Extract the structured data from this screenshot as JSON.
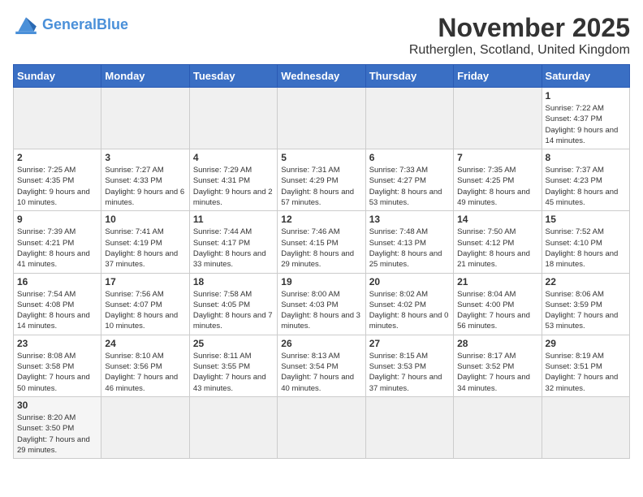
{
  "logo": {
    "general": "General",
    "blue": "Blue"
  },
  "header": {
    "month": "November 2025",
    "location": "Rutherglen, Scotland, United Kingdom"
  },
  "days_of_week": [
    "Sunday",
    "Monday",
    "Tuesday",
    "Wednesday",
    "Thursday",
    "Friday",
    "Saturday"
  ],
  "weeks": [
    [
      {
        "day": "",
        "info": ""
      },
      {
        "day": "",
        "info": ""
      },
      {
        "day": "",
        "info": ""
      },
      {
        "day": "",
        "info": ""
      },
      {
        "day": "",
        "info": ""
      },
      {
        "day": "",
        "info": ""
      },
      {
        "day": "1",
        "info": "Sunrise: 7:22 AM\nSunset: 4:37 PM\nDaylight: 9 hours and 14 minutes."
      }
    ],
    [
      {
        "day": "2",
        "info": "Sunrise: 7:25 AM\nSunset: 4:35 PM\nDaylight: 9 hours and 10 minutes."
      },
      {
        "day": "3",
        "info": "Sunrise: 7:27 AM\nSunset: 4:33 PM\nDaylight: 9 hours and 6 minutes."
      },
      {
        "day": "4",
        "info": "Sunrise: 7:29 AM\nSunset: 4:31 PM\nDaylight: 9 hours and 2 minutes."
      },
      {
        "day": "5",
        "info": "Sunrise: 7:31 AM\nSunset: 4:29 PM\nDaylight: 8 hours and 57 minutes."
      },
      {
        "day": "6",
        "info": "Sunrise: 7:33 AM\nSunset: 4:27 PM\nDaylight: 8 hours and 53 minutes."
      },
      {
        "day": "7",
        "info": "Sunrise: 7:35 AM\nSunset: 4:25 PM\nDaylight: 8 hours and 49 minutes."
      },
      {
        "day": "8",
        "info": "Sunrise: 7:37 AM\nSunset: 4:23 PM\nDaylight: 8 hours and 45 minutes."
      }
    ],
    [
      {
        "day": "9",
        "info": "Sunrise: 7:39 AM\nSunset: 4:21 PM\nDaylight: 8 hours and 41 minutes."
      },
      {
        "day": "10",
        "info": "Sunrise: 7:41 AM\nSunset: 4:19 PM\nDaylight: 8 hours and 37 minutes."
      },
      {
        "day": "11",
        "info": "Sunrise: 7:44 AM\nSunset: 4:17 PM\nDaylight: 8 hours and 33 minutes."
      },
      {
        "day": "12",
        "info": "Sunrise: 7:46 AM\nSunset: 4:15 PM\nDaylight: 8 hours and 29 minutes."
      },
      {
        "day": "13",
        "info": "Sunrise: 7:48 AM\nSunset: 4:13 PM\nDaylight: 8 hours and 25 minutes."
      },
      {
        "day": "14",
        "info": "Sunrise: 7:50 AM\nSunset: 4:12 PM\nDaylight: 8 hours and 21 minutes."
      },
      {
        "day": "15",
        "info": "Sunrise: 7:52 AM\nSunset: 4:10 PM\nDaylight: 8 hours and 18 minutes."
      }
    ],
    [
      {
        "day": "16",
        "info": "Sunrise: 7:54 AM\nSunset: 4:08 PM\nDaylight: 8 hours and 14 minutes."
      },
      {
        "day": "17",
        "info": "Sunrise: 7:56 AM\nSunset: 4:07 PM\nDaylight: 8 hours and 10 minutes."
      },
      {
        "day": "18",
        "info": "Sunrise: 7:58 AM\nSunset: 4:05 PM\nDaylight: 8 hours and 7 minutes."
      },
      {
        "day": "19",
        "info": "Sunrise: 8:00 AM\nSunset: 4:03 PM\nDaylight: 8 hours and 3 minutes."
      },
      {
        "day": "20",
        "info": "Sunrise: 8:02 AM\nSunset: 4:02 PM\nDaylight: 8 hours and 0 minutes."
      },
      {
        "day": "21",
        "info": "Sunrise: 8:04 AM\nSunset: 4:00 PM\nDaylight: 7 hours and 56 minutes."
      },
      {
        "day": "22",
        "info": "Sunrise: 8:06 AM\nSunset: 3:59 PM\nDaylight: 7 hours and 53 minutes."
      }
    ],
    [
      {
        "day": "23",
        "info": "Sunrise: 8:08 AM\nSunset: 3:58 PM\nDaylight: 7 hours and 50 minutes."
      },
      {
        "day": "24",
        "info": "Sunrise: 8:10 AM\nSunset: 3:56 PM\nDaylight: 7 hours and 46 minutes."
      },
      {
        "day": "25",
        "info": "Sunrise: 8:11 AM\nSunset: 3:55 PM\nDaylight: 7 hours and 43 minutes."
      },
      {
        "day": "26",
        "info": "Sunrise: 8:13 AM\nSunset: 3:54 PM\nDaylight: 7 hours and 40 minutes."
      },
      {
        "day": "27",
        "info": "Sunrise: 8:15 AM\nSunset: 3:53 PM\nDaylight: 7 hours and 37 minutes."
      },
      {
        "day": "28",
        "info": "Sunrise: 8:17 AM\nSunset: 3:52 PM\nDaylight: 7 hours and 34 minutes."
      },
      {
        "day": "29",
        "info": "Sunrise: 8:19 AM\nSunset: 3:51 PM\nDaylight: 7 hours and 32 minutes."
      }
    ],
    [
      {
        "day": "30",
        "info": "Sunrise: 8:20 AM\nSunset: 3:50 PM\nDaylight: 7 hours and 29 minutes."
      },
      {
        "day": "",
        "info": ""
      },
      {
        "day": "",
        "info": ""
      },
      {
        "day": "",
        "info": ""
      },
      {
        "day": "",
        "info": ""
      },
      {
        "day": "",
        "info": ""
      },
      {
        "day": "",
        "info": ""
      }
    ]
  ]
}
